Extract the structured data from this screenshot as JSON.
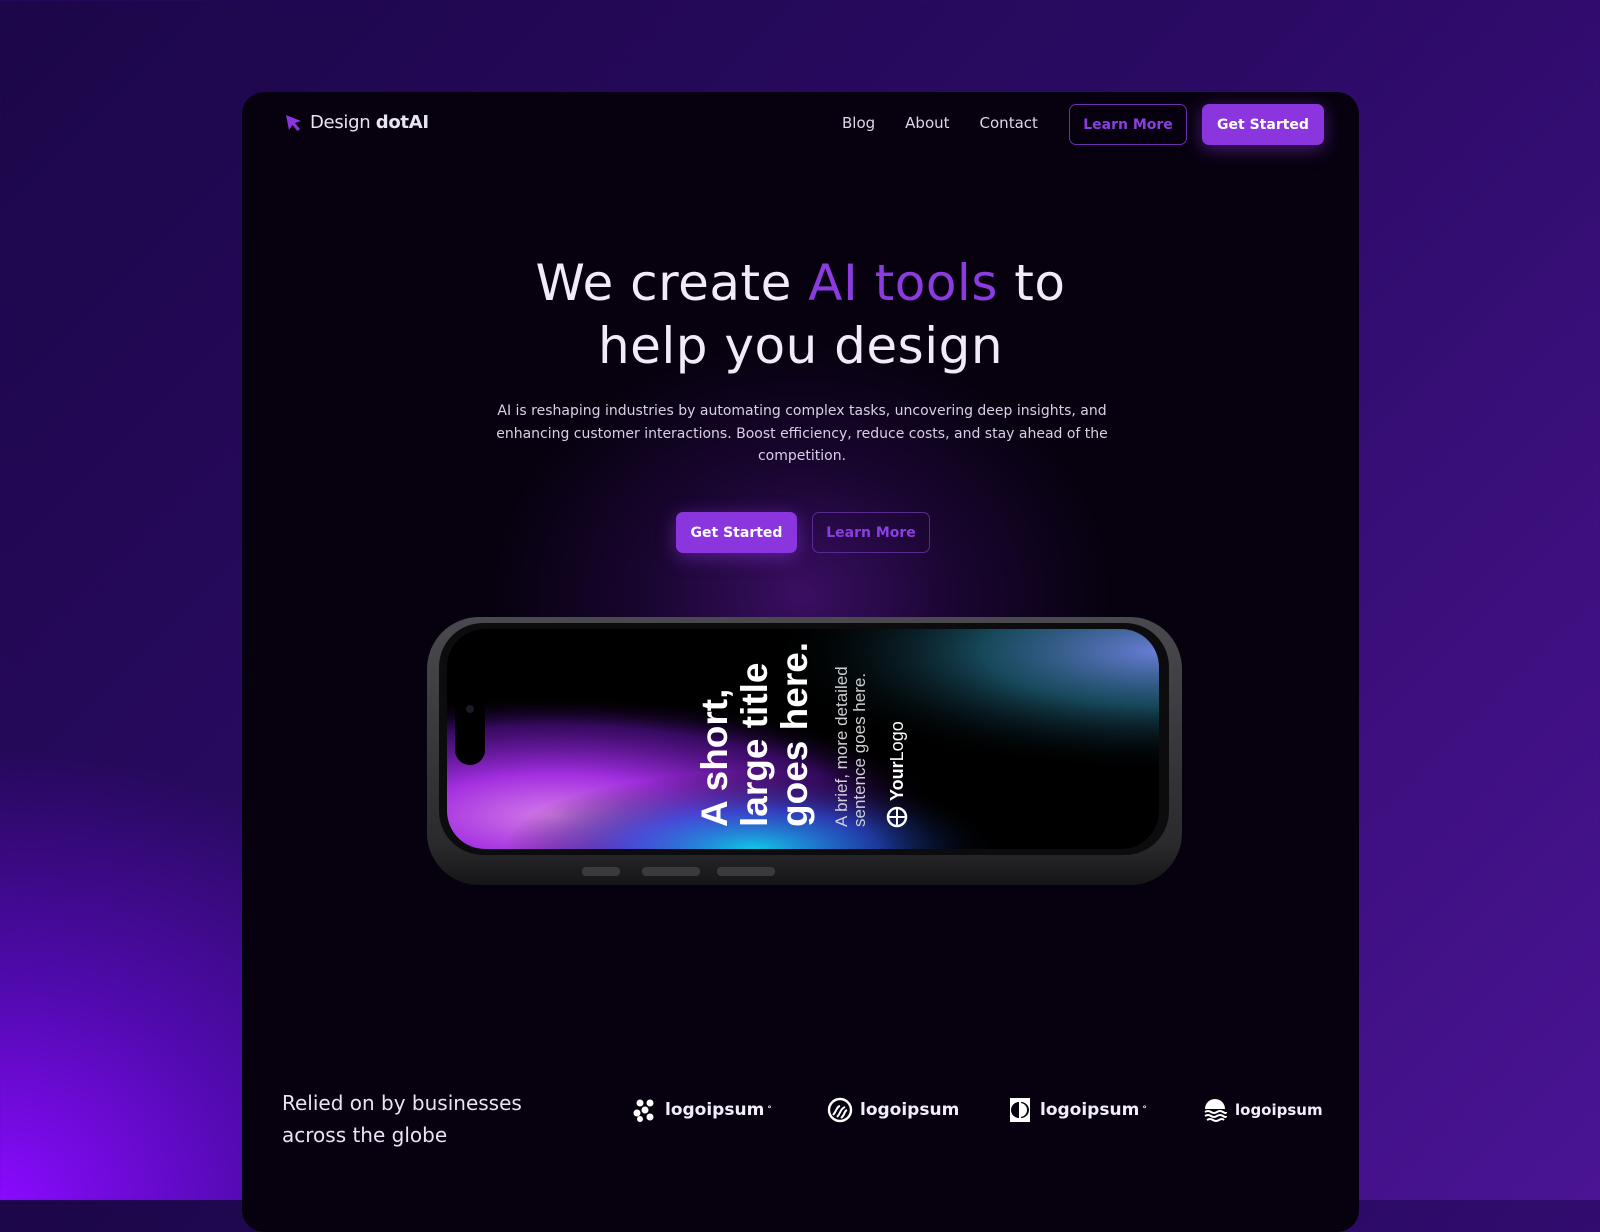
{
  "brand": {
    "name_light": "Design ",
    "name_bold": "dotAI",
    "icon": "cursor-arrow-icon",
    "accent": "#8a35dd"
  },
  "nav": {
    "links": [
      "Blog",
      "About",
      "Contact"
    ],
    "learn_more": "Learn More",
    "get_started": "Get Started"
  },
  "hero": {
    "title_part1": "We create ",
    "title_accent": "AI tools",
    "title_part2": " to",
    "title_line2": "help you design",
    "description": "AI is reshaping industries by automating complex tasks, uncovering deep insights, and enhancing customer interactions. Boost efficiency, reduce costs, and stay ahead of the competition.",
    "get_started": "Get Started",
    "learn_more": "Learn More"
  },
  "phone": {
    "title_lines": [
      "A short,",
      "large title",
      "goes here."
    ],
    "subtitle_lines": [
      "A brief, more detailed",
      "sentence goes here."
    ],
    "logo_bold": "Your",
    "logo_light": "Logo"
  },
  "trusted": {
    "line1": "Relied on by businesses",
    "line2": "across the globe",
    "logos": [
      {
        "name": "logoipsum",
        "mark": "°",
        "icon": "dots-cluster-icon"
      },
      {
        "name": "logoipsum",
        "mark": "",
        "icon": "circle-wave-icon"
      },
      {
        "name": "logoipsum",
        "mark": "°",
        "icon": "half-circle-icon"
      },
      {
        "name": "logoipsum",
        "mark": "",
        "icon": "waves-dome-icon"
      }
    ]
  },
  "colors": {
    "background_dark": "#07010f",
    "accent": "#8a35dd",
    "text": "#f1eaf7"
  }
}
